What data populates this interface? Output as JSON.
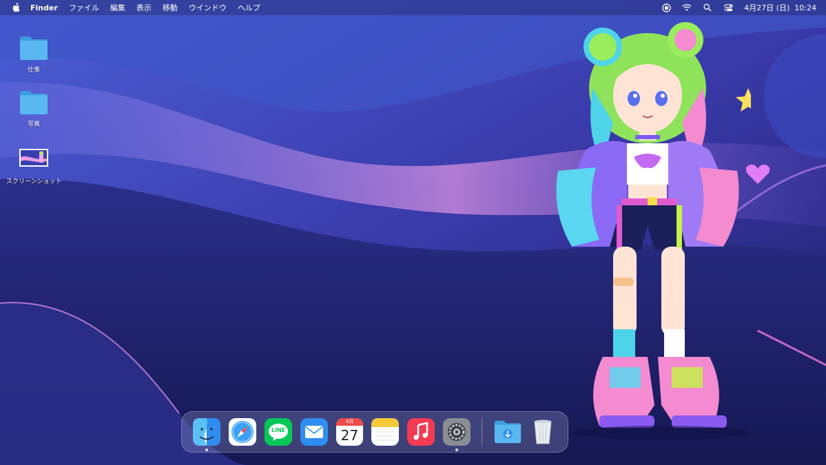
{
  "menubar": {
    "apple_icon": "apple-icon",
    "app_name": "Finder",
    "menus": [
      "ファイル",
      "編集",
      "表示",
      "移動",
      "ウインドウ",
      "ヘルプ"
    ],
    "status_icons": [
      "screen-record-icon",
      "wifi-icon",
      "search-icon",
      "control-center-icon"
    ],
    "clock": "4月27日 (日)  10:24"
  },
  "desktop": {
    "icons": [
      {
        "label": "仕事",
        "icon": "folder-icon"
      },
      {
        "label": "写真",
        "icon": "folder-icon"
      },
      {
        "label": "スクリーンショット",
        "icon": "screenshot-thumbnail"
      }
    ]
  },
  "dock": {
    "apps": [
      {
        "name": "Finder",
        "icon": "finder-icon",
        "running": true
      },
      {
        "name": "Safari",
        "icon": "safari-icon",
        "running": false
      },
      {
        "name": "LINE",
        "icon": "line-icon",
        "running": false,
        "text": "LINE"
      },
      {
        "name": "Mail",
        "icon": "mail-icon",
        "running": false
      },
      {
        "name": "Calendar",
        "icon": "calendar-icon",
        "running": false,
        "month": "4月",
        "day": "27"
      },
      {
        "name": "Notes",
        "icon": "notes-icon",
        "running": false
      },
      {
        "name": "Music",
        "icon": "music-icon",
        "running": false
      },
      {
        "name": "System Settings",
        "icon": "settings-icon",
        "running": true
      }
    ],
    "downloads": {
      "name": "Downloads",
      "icon": "downloads-folder-icon"
    },
    "trash": {
      "name": "Trash",
      "icon": "trash-icon"
    }
  },
  "colors": {
    "folder": "#5ab8f0",
    "wallpaper_deep": "#1a1f66",
    "wallpaper_glow": "#e67ad8"
  }
}
